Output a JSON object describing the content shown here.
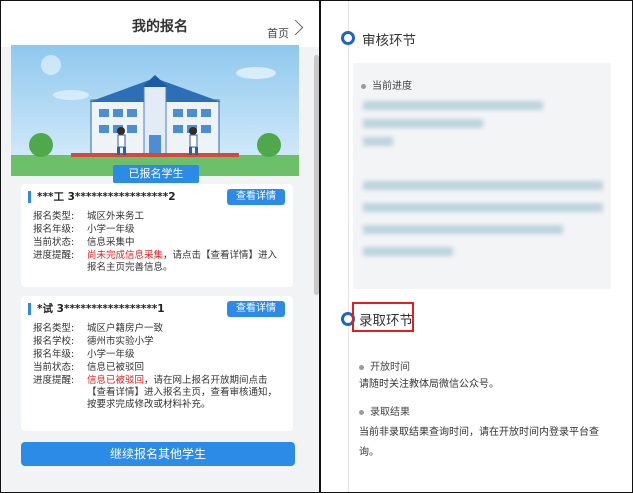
{
  "left": {
    "header": {
      "title": "我的报名",
      "home_label": "首页"
    },
    "section_tag": "已报名学生",
    "cards": [
      {
        "name": "***工  3*****************2",
        "button": "查看详情",
        "rows": [
          {
            "label": "报名类型:",
            "value": "城区外来务工"
          },
          {
            "label": "报名年级:",
            "value": "小学一年级"
          },
          {
            "label": "当前状态:",
            "value": "信息采集中"
          }
        ],
        "reminder_label": "进度提醒:",
        "reminder_red": "尚未完成信息采集",
        "reminder_text": "，请点击【查看详情】进入报名主页完善信息。"
      },
      {
        "name": "*试  3*****************1",
        "button": "查看详情",
        "rows": [
          {
            "label": "报名类型:",
            "value": "城区户籍房户一致"
          },
          {
            "label": "报名学校:",
            "value": "德州市实验小学"
          },
          {
            "label": "报名年级:",
            "value": "小学一年级"
          },
          {
            "label": "当前状态:",
            "value": "信息已被驳回"
          }
        ],
        "reminder_label": "进度提醒:",
        "reminder_red": "信息已被驳回",
        "reminder_text": "，请在网上报名开放期间点击【查看详情】进入报名主页，查看审核通知，按要求完成修改或材料补充。"
      }
    ],
    "cta": "继续报名其他学生"
  },
  "right": {
    "review": {
      "title": "审核环节",
      "progress_label": "当前进度"
    },
    "admission": {
      "title": "录取环节",
      "open_time_label": "开放时间",
      "open_time_text": "请随时关注教体局微信公众号。",
      "result_label": "录取结果",
      "result_text": "当前非录取结果查询时间，请在开放时间内登录平台查询。"
    }
  },
  "colors": {
    "accent": "#2b8be6",
    "ring": "#1e64c8",
    "highlight": "#e02020"
  }
}
